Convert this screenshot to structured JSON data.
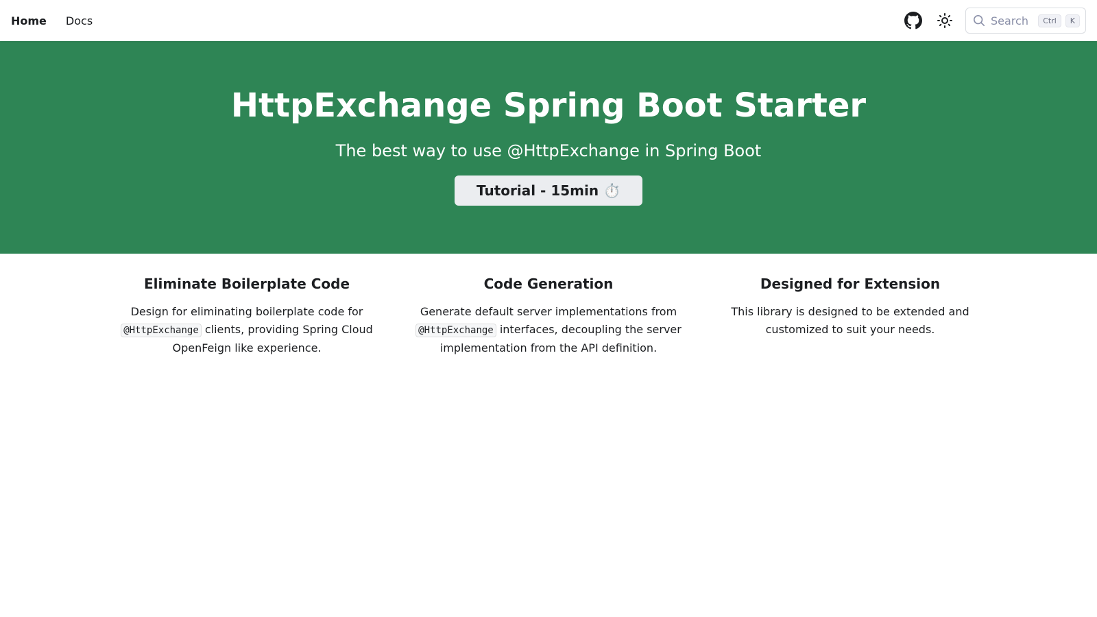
{
  "nav": {
    "links": [
      {
        "label": "Home",
        "active": true
      },
      {
        "label": "Docs",
        "active": false
      }
    ],
    "github_icon": "github-icon",
    "theme_icon": "sun-icon",
    "search": {
      "placeholder": "Search",
      "shortcut": [
        "Ctrl",
        "K"
      ]
    }
  },
  "hero": {
    "title": "HttpExchange Spring Boot Starter",
    "subtitle": "The best way to use @HttpExchange in Spring Boot",
    "button_label": "Tutorial - 15min ⏱️",
    "background": "#2e8555"
  },
  "features": [
    {
      "title": "Eliminate Boilerplate Code",
      "text_before": "Design for eliminating boilerplate code for",
      "code": "@HttpExchange",
      "text_after": "clients, providing Spring Cloud OpenFeign like experience."
    },
    {
      "title": "Code Generation",
      "text_before": "Generate default server implementations from",
      "code": "@HttpExchange",
      "text_after": "interfaces, decoupling the server implementation from the API definition."
    },
    {
      "title": "Designed for Extension",
      "text_before": "This library is designed to be extended and customized to suit your needs.",
      "code": "",
      "text_after": ""
    }
  ]
}
